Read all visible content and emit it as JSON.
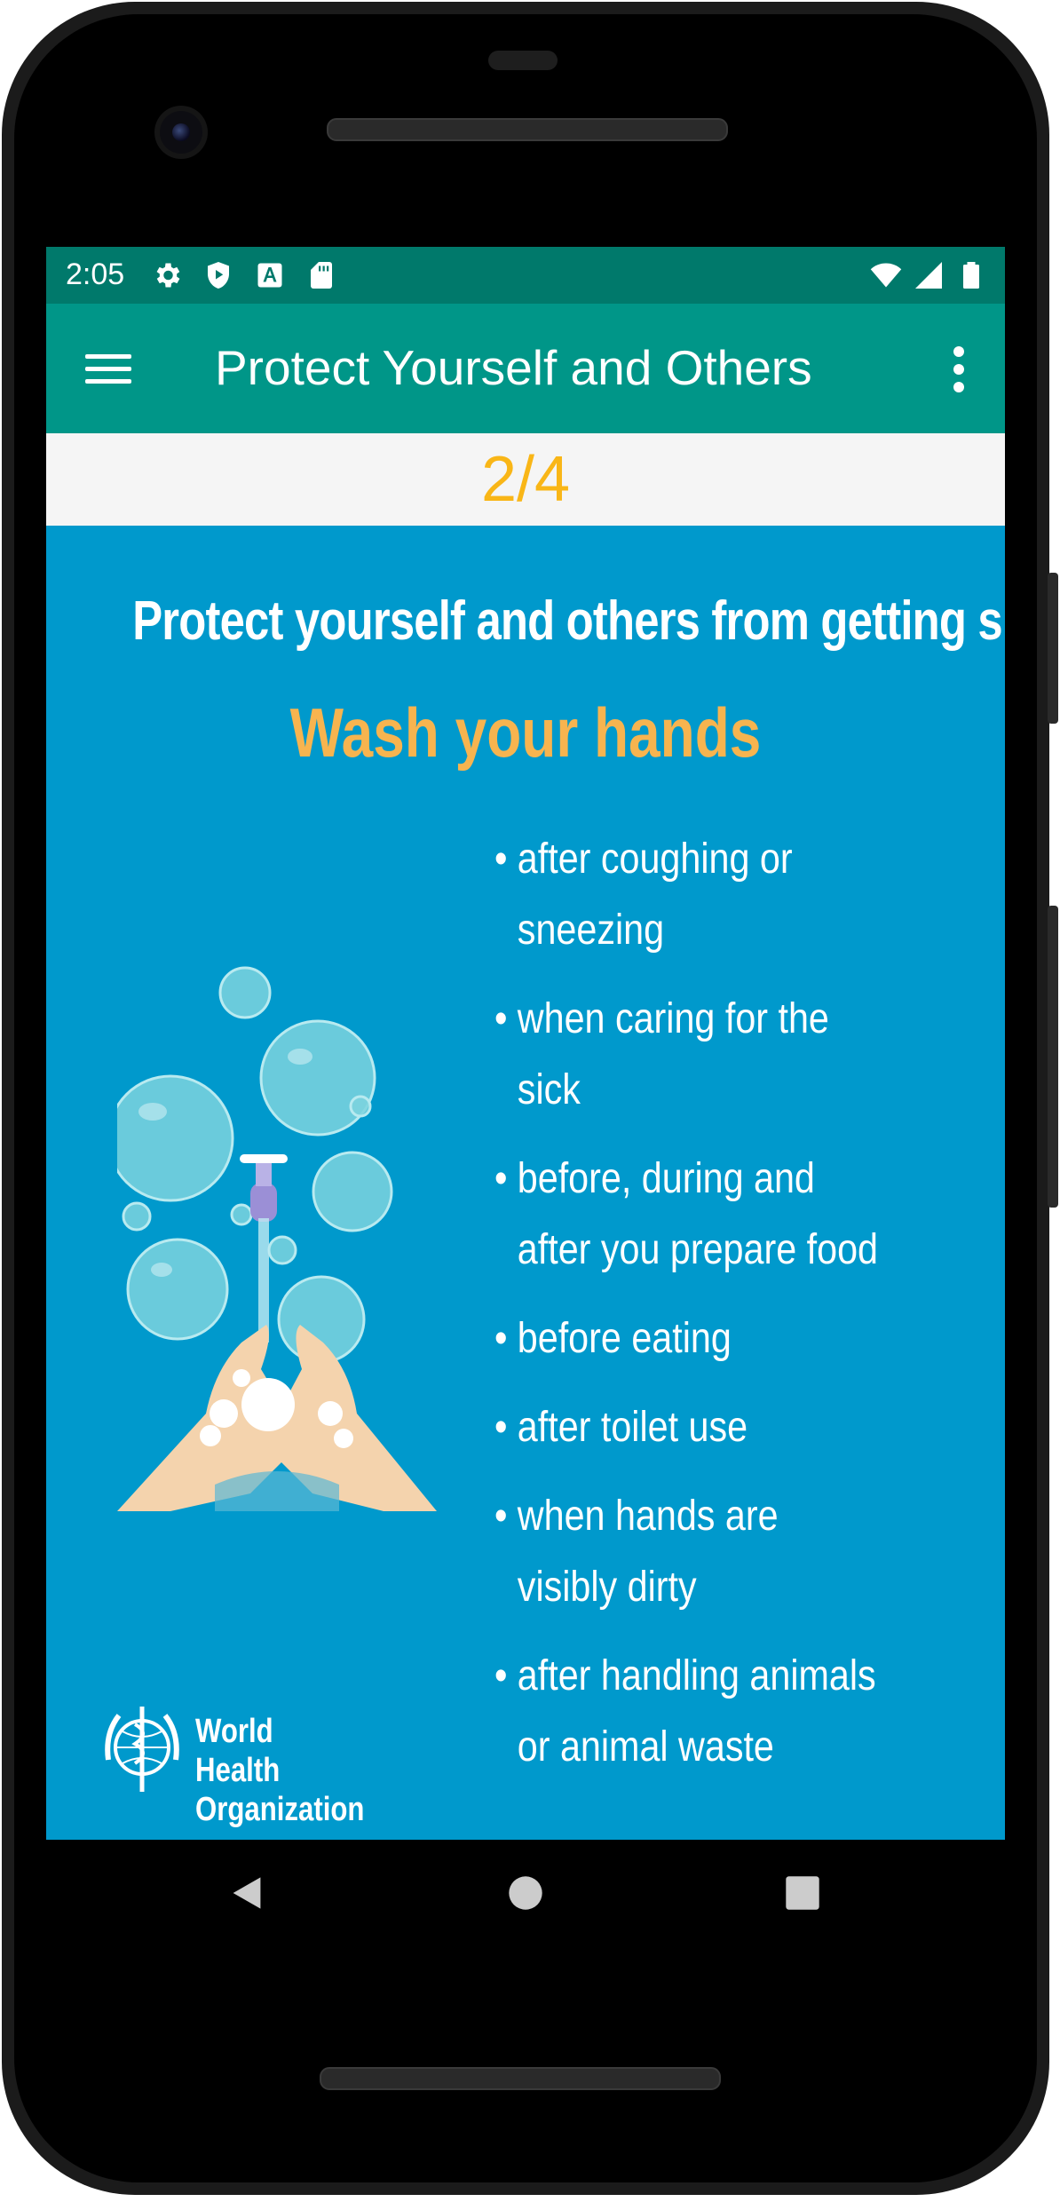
{
  "status_bar": {
    "time": "2:05",
    "left_icons": [
      "settings-icon",
      "shield-play-icon",
      "font-a-icon",
      "sd-card-icon"
    ],
    "right_icons": [
      "wifi-icon",
      "cell-signal-icon",
      "battery-icon"
    ]
  },
  "app_bar": {
    "title": "Protect Yourself and Others",
    "color": "#009688",
    "status_color": "#00796b"
  },
  "pager": {
    "indicator": "2/4",
    "color": "#f9b617"
  },
  "poster": {
    "background": "#0099cc",
    "heading": "Protect yourself and others from getting sick",
    "subheading": "Wash your hands",
    "bullets": [
      "after coughing or\nsneezing",
      "when caring for the\nsick",
      "before, during and\nafter you prepare food",
      "before eating",
      "after toilet use",
      "when hands are\nvisibly dirty",
      "after handling animals\nor animal waste"
    ],
    "logo_text": "World Health\nOrganization"
  },
  "nav_bar": {
    "buttons": [
      "back-icon",
      "home-icon",
      "recents-icon"
    ]
  }
}
